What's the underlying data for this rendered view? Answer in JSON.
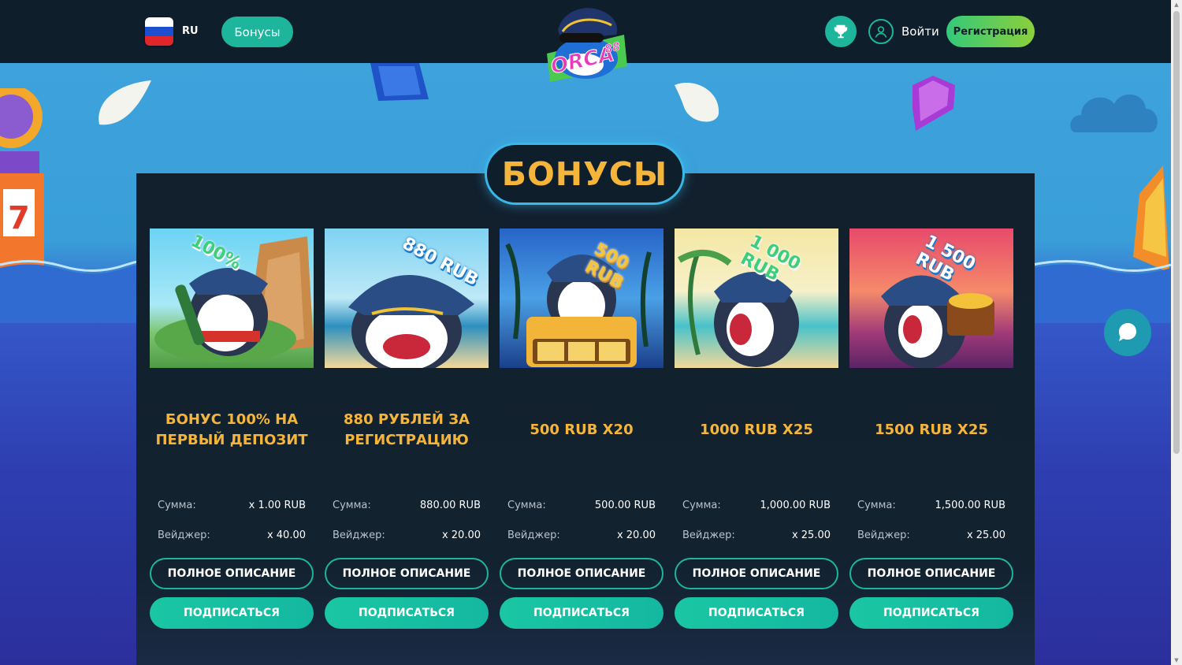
{
  "header": {
    "lang_label": "RU",
    "nav_bonus_label": "Бонусы",
    "logo_text": "ORCA",
    "logo_number": "88",
    "login_label": "Войти",
    "register_label": "Регистрация"
  },
  "page_title": "БОНУСЫ",
  "labels": {
    "amount": "Сумма:",
    "wager": "Вейджер:",
    "full_description": "ПОЛНОЕ ОПИСАНИЕ",
    "subscribe": "ПОДПИСАТЬСЯ"
  },
  "cards": [
    {
      "image_text": "100%",
      "title": "БОНУС 100% НА ПЕРВЫЙ ДЕПОЗИТ",
      "amount": "x 1.00 RUB",
      "wager": "x 40.00"
    },
    {
      "image_text": "880 RUB",
      "title": "880 РУБЛЕЙ ЗА РЕГИСТРАЦИЮ",
      "amount": "880.00 RUB",
      "wager": "x 20.00"
    },
    {
      "image_text": "500 RUB",
      "title": "500 RUB X20",
      "amount": "500.00 RUB",
      "wager": "x 20.00"
    },
    {
      "image_text": "1 000 RUB",
      "title": "1000 RUB X25",
      "amount": "1,000.00 RUB",
      "wager": "x 25.00"
    },
    {
      "image_text": "1 500 RUB",
      "title": "1500 RUB X25",
      "amount": "1,500.00 RUB",
      "wager": "x 25.00"
    }
  ],
  "colors": {
    "accent": "#1db59b",
    "title": "#f5b53a",
    "header_bg": "#0f1e2b",
    "panel_bg": "#12202e"
  }
}
